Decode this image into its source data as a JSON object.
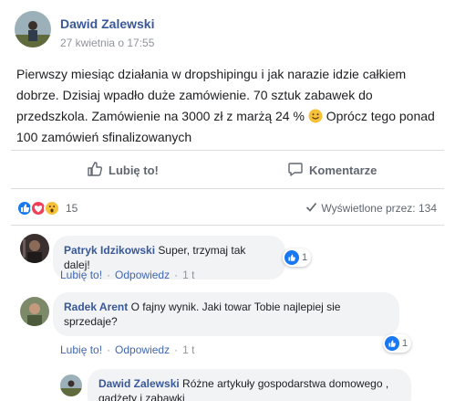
{
  "post": {
    "author": "Dawid Zalewski",
    "time": "27 kwietnia o 17:55",
    "text_before_emoji": "Pierwszy miesiąc działania w dropshipingu i jak narazie idzie całkiem dobrze. Dzisiaj wpadło duże zamówienie. 70 sztuk zabawek do przedszkola. Zamówienie na 3000 zł z marżą 24 % ",
    "text_after_emoji": " Oprócz tego ponad 100 zamówień sfinalizowanych",
    "emoji_icon": "smiling-face-icon"
  },
  "actions": {
    "like_label": "Lubię to!",
    "comment_label": "Komentarze"
  },
  "reactions": {
    "icons": [
      "like-icon",
      "love-icon",
      "wow-icon"
    ],
    "count": "15",
    "seen_label": "Wyświetlone przez: 134"
  },
  "comments": [
    {
      "author": "Patryk Idzikowski",
      "text": "Super, trzymaj tak dalej!",
      "likes": "1",
      "like_link": "Lubię to!",
      "reply_link": "Odpowiedz",
      "time": "1 t"
    },
    {
      "author": "Radek Arent",
      "text": "O fajny wynik. Jaki towar Tobie najlepiej sie sprzedaje?",
      "likes": "1",
      "like_link": "Lubię to!",
      "reply_link": "Odpowiedz",
      "time": "1 t"
    }
  ],
  "reply": {
    "author": "Dawid Zalewski",
    "text": "Różne artykuły gospodarstwa domowego , gadżety i zabawki"
  },
  "colors": {
    "link_blue": "#385898",
    "like_blue": "#1877f2",
    "meta_gray": "#90949c",
    "bubble_gray": "#f2f3f5"
  }
}
